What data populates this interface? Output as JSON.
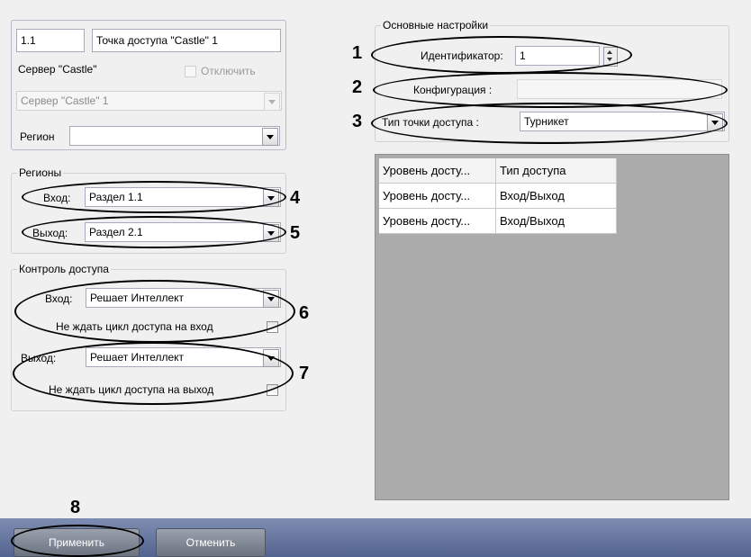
{
  "top_panel": {
    "id_value": "1.1",
    "name_value": "Точка доступа \"Castle\" 1",
    "server_label": "Сервер \"Castle\"",
    "disable_label": "Отключить",
    "server_select": "Сервер \"Castle\" 1",
    "region_label": "Регион",
    "region_select": ""
  },
  "regions": {
    "title": "Регионы",
    "entry_label": "Вход:",
    "entry_value": "Раздел 1.1",
    "exit_label": "Выход:",
    "exit_value": "Раздел 2.1"
  },
  "access_control": {
    "title": "Контроль доступа",
    "entry_label": "Вход:",
    "entry_value": "Решает Интеллект",
    "entry_wait_label": "Не ждать цикл доступа на вход",
    "exit_label": "Выход:",
    "exit_value": "Решает Интеллект",
    "exit_wait_label": "Не ждать цикл доступа на выход"
  },
  "main_settings": {
    "title": "Основные настройки",
    "identifier_label": "Идентификатор:",
    "identifier_value": "1",
    "configuration_label": "Конфигурация :",
    "configuration_value": "",
    "access_type_label": "Тип точки доступа :",
    "access_type_value": "Турникет"
  },
  "access_table": {
    "headers": [
      "Уровень досту...",
      "Тип доступа"
    ],
    "rows": [
      [
        "Уровень досту...",
        "Вход/Выход"
      ],
      [
        "Уровень досту...",
        "Вход/Выход"
      ]
    ]
  },
  "buttons": {
    "apply": "Применить",
    "cancel": "Отменить"
  },
  "callouts": [
    "1",
    "2",
    "3",
    "4",
    "5",
    "6",
    "7",
    "8"
  ]
}
